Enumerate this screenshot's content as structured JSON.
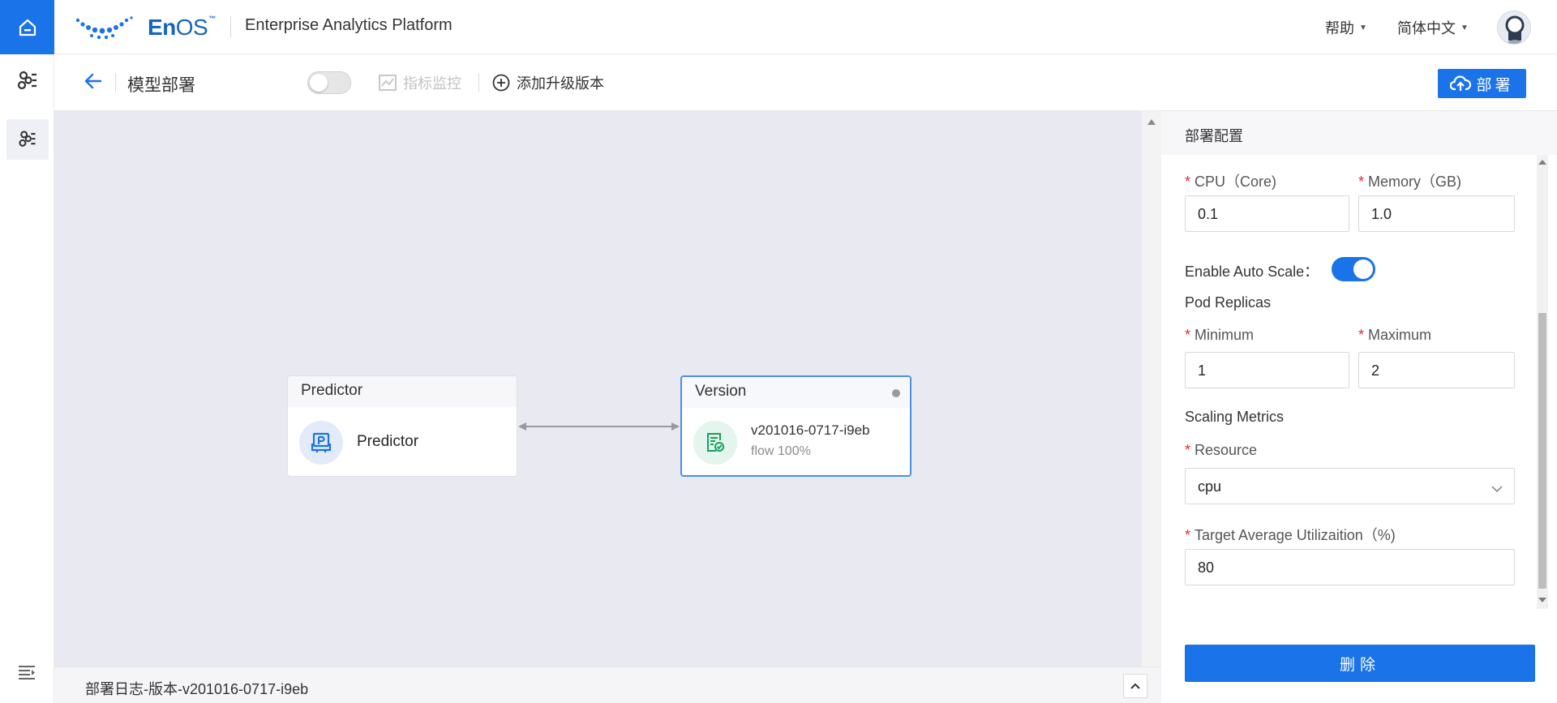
{
  "header": {
    "logo_text_bold": "En",
    "logo_text_light": "OS",
    "logo_tm": "™",
    "app_title": "Enterprise Analytics Platform",
    "help_label": "帮助",
    "language_label": "简体中文"
  },
  "toolbar": {
    "page_title": "模型部署",
    "monitor_label": "指标监控",
    "add_version_label": "添加升级版本",
    "deploy_label": "部署"
  },
  "canvas": {
    "predictor_node": {
      "header": "Predictor",
      "label": "Predictor"
    },
    "version_node": {
      "header": "Version",
      "version_name": "v201016-0717-i9eb",
      "flow": "flow 100%"
    }
  },
  "logbar": {
    "text": "部署日志-版本-v201016-0717-i9eb"
  },
  "panel": {
    "title": "部署配置",
    "cpu_label": "CPU（Core)",
    "cpu_value": "0.1",
    "memory_label": "Memory（GB)",
    "memory_value": "1.0",
    "auto_scale_label": "Enable Auto Scale：",
    "auto_scale_on": true,
    "pod_replicas_label": "Pod Replicas",
    "minimum_label": "Minimum",
    "minimum_value": "1",
    "maximum_label": "Maximum",
    "maximum_value": "2",
    "scaling_metrics_label": "Scaling Metrics",
    "resource_label": "Resource",
    "resource_value": "cpu",
    "target_label": "Target Average Utilizaition（%)",
    "target_value": "80",
    "delete_label": "删除",
    "required_mark": "*"
  },
  "colors": {
    "primary": "#1a73e8",
    "required": "#f5222d",
    "canvas_bg": "#e8e9f1"
  }
}
